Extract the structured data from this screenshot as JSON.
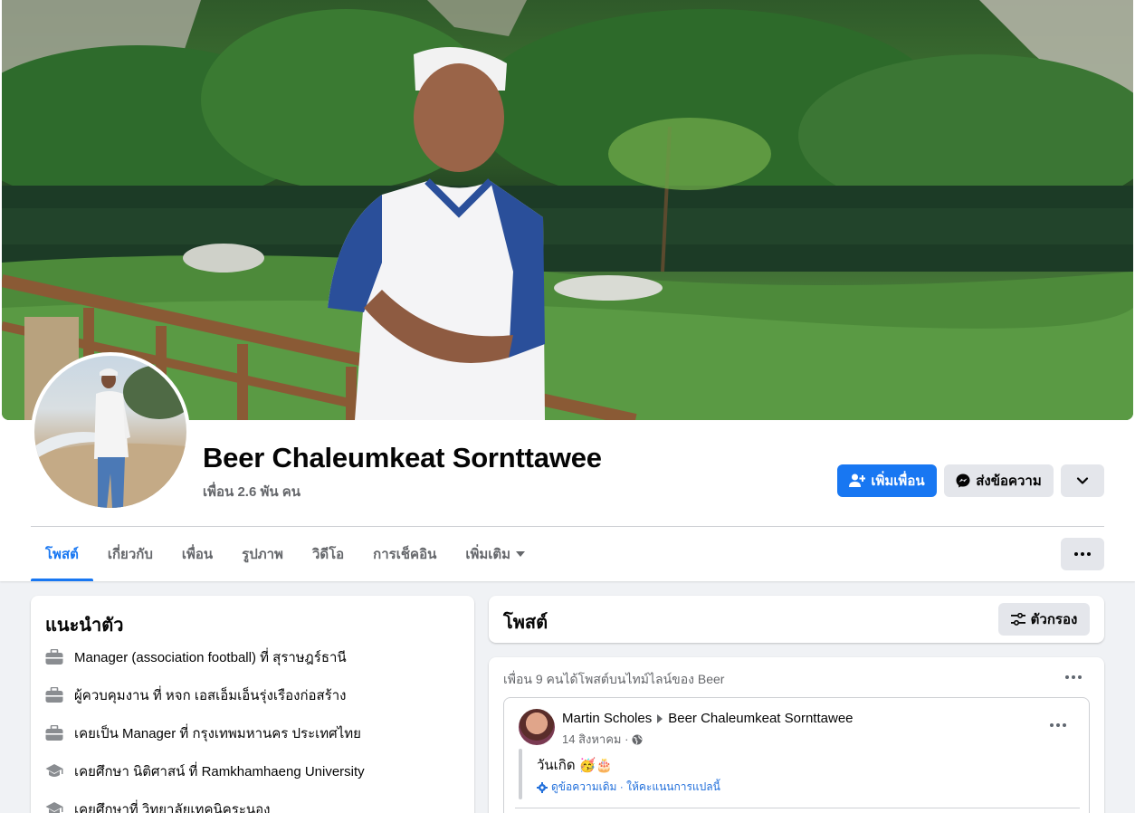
{
  "profile": {
    "name": "Beer Chaleumkeat Sornttawee",
    "friends": "เพื่อน 2.6 พัน คน"
  },
  "actions": {
    "add_friend": "เพิ่มเพื่อน",
    "message": "ส่งข้อความ"
  },
  "tabs": [
    {
      "label": "โพสต์",
      "active": true
    },
    {
      "label": "เกี่ยวกับ",
      "active": false
    },
    {
      "label": "เพื่อน",
      "active": false
    },
    {
      "label": "รูปภาพ",
      "active": false
    },
    {
      "label": "วิดีโอ",
      "active": false
    },
    {
      "label": "การเช็คอิน",
      "active": false
    },
    {
      "label": "เพิ่มเติม",
      "active": false
    }
  ],
  "intro": {
    "title": "แนะนำตัว",
    "items": [
      {
        "icon": "briefcase-icon",
        "text": "Manager (association football) ที่ สุราษฎร์ธานี"
      },
      {
        "icon": "briefcase-icon",
        "text": "ผู้ควบคุมงาน ที่ หจก เอสเอ็มเอ็นรุ่งเรืองก่อสร้าง"
      },
      {
        "icon": "briefcase-icon",
        "text": "เคยเป็น Manager ที่ กรุงเทพมหานคร ประเทศไทย"
      },
      {
        "icon": "graduation-cap-icon",
        "text": "เคยศึกษา นิติศาสน์ ที่ Ramkhamhaeng University"
      },
      {
        "icon": "graduation-cap-icon",
        "text": "เคยศึกษาที่ วิทยาลัยเทคนิคระนอง"
      }
    ]
  },
  "posts": {
    "title": "โพสต์",
    "filter_label": "ตัวกรอง"
  },
  "feed": {
    "note": "เพื่อน 9 คนได้โพสต์บนไทม์ไลน์ของ Beer",
    "post": {
      "author": "Martin Scholes",
      "target": "Beer Chaleumkeat Sornttawee",
      "time": "14 สิงหาคม ·",
      "text": "วันเกิด",
      "emoji": "🥳🎂",
      "translate": "ดูข้อความเดิม · ให้คะแนนการแปลนี้"
    }
  },
  "colors": {
    "primary": "#1877f2",
    "secondary_bg": "#e4e6eb",
    "muted_text": "#65676b",
    "page_bg": "#f0f2f5"
  }
}
